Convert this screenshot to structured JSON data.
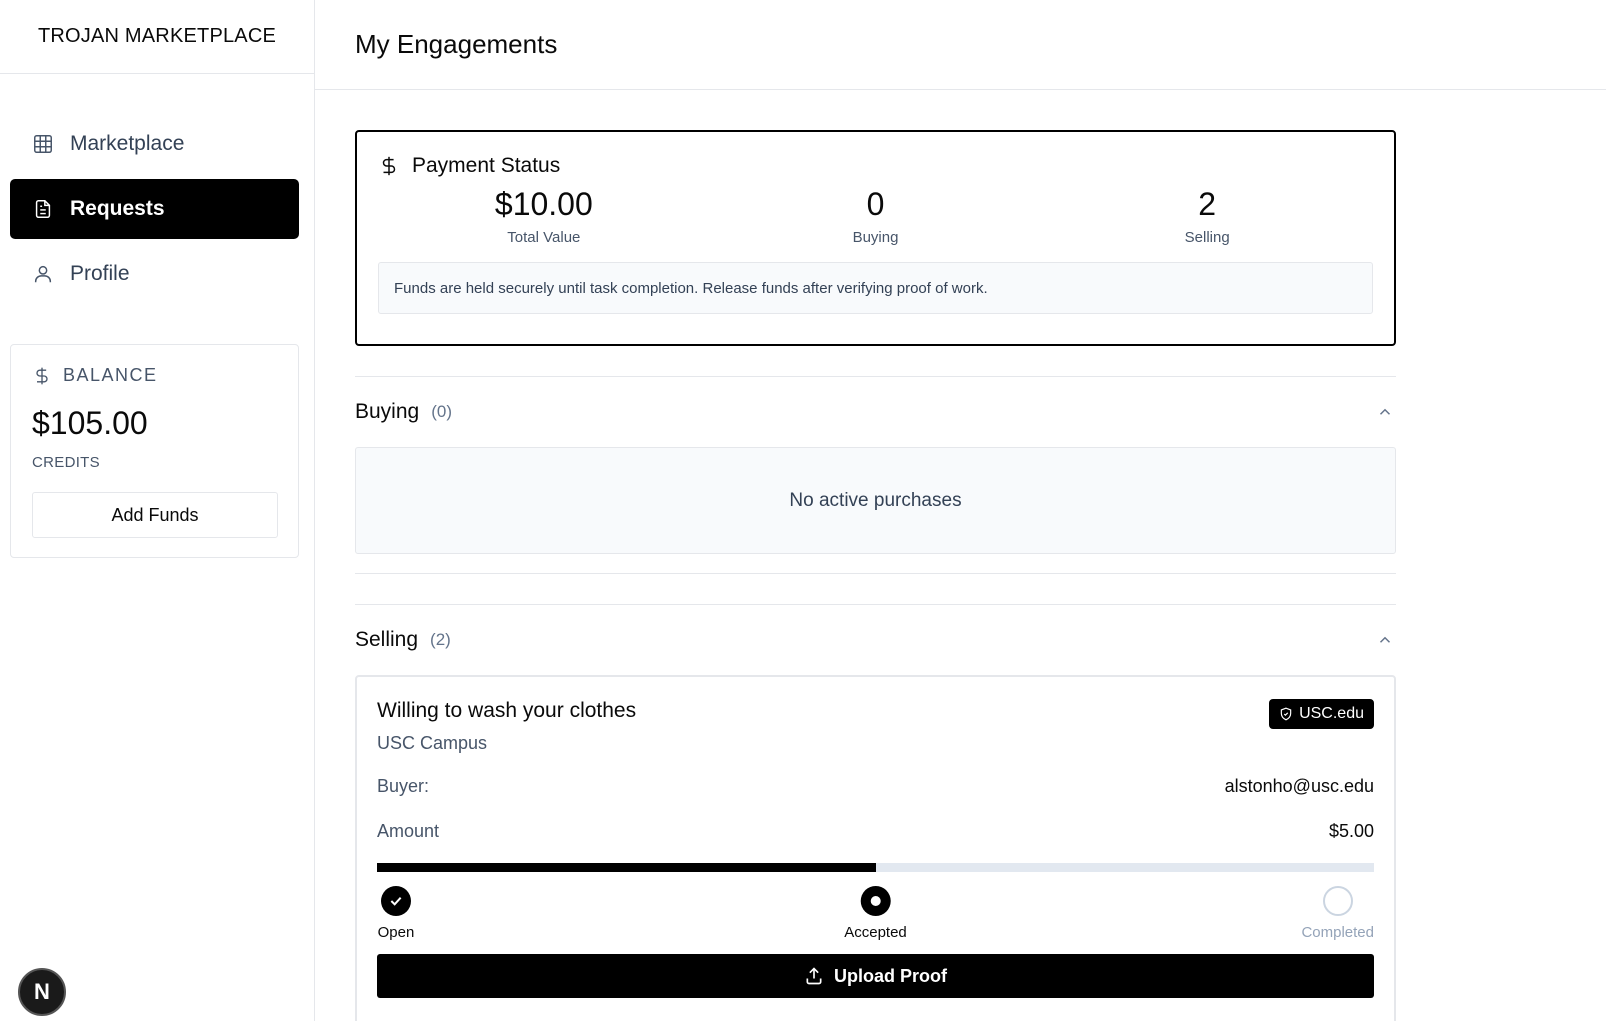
{
  "sidebar": {
    "brand": "TROJAN MARKETPLACE",
    "nav": [
      {
        "label": "Marketplace",
        "icon": "grid-icon",
        "active": false
      },
      {
        "label": "Requests",
        "icon": "document-icon",
        "active": true
      },
      {
        "label": "Profile",
        "icon": "user-icon",
        "active": false
      }
    ],
    "balance": {
      "heading": "BALANCE",
      "amount": "$105.00",
      "unit": "CREDITS",
      "add_funds_label": "Add Funds"
    },
    "framework_badge": "N"
  },
  "main": {
    "title": "My Engagements",
    "payment_status": {
      "heading": "Payment Status",
      "stats": [
        {
          "value": "$10.00",
          "label": "Total Value"
        },
        {
          "value": "0",
          "label": "Buying"
        },
        {
          "value": "2",
          "label": "Selling"
        }
      ],
      "note": "Funds are held securely until task completion. Release funds after verifying proof of work."
    },
    "buying": {
      "title": "Buying",
      "count": "(0)",
      "empty_text": "No active purchases"
    },
    "selling": {
      "title": "Selling",
      "count": "(2)",
      "items": [
        {
          "title": "Willing to wash your clothes",
          "location": "USC Campus",
          "badge": "USC.edu",
          "buyer_label": "Buyer:",
          "buyer": "alstonho@usc.edu",
          "amount_label": "Amount",
          "amount": "$5.00",
          "progress": 0.5,
          "steps": [
            {
              "label": "Open",
              "state": "done"
            },
            {
              "label": "Accepted",
              "state": "current"
            },
            {
              "label": "Completed",
              "state": "todo"
            }
          ],
          "action_label": "Upload Proof"
        }
      ]
    }
  },
  "colors": {
    "primary": "#000000",
    "muted_text": "#475569",
    "border": "#e5e7eb",
    "panel_bg": "#f8fafc"
  }
}
